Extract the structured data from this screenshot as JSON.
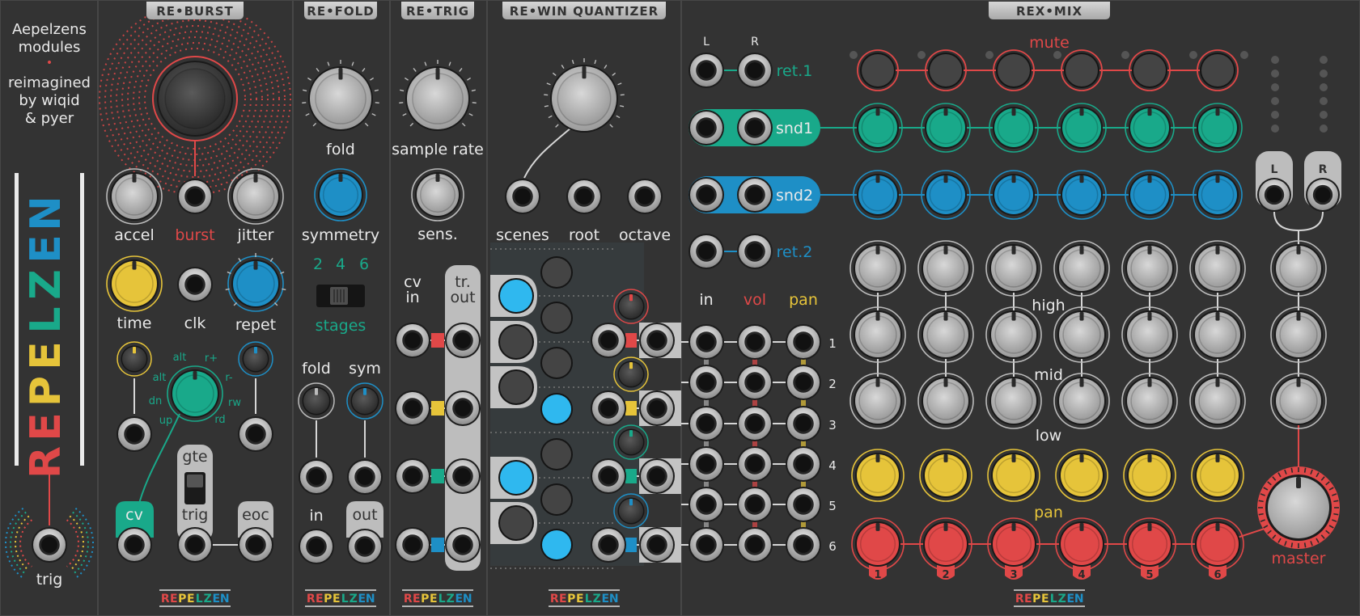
{
  "colors": {
    "panel": "#333333",
    "panel_edge": "#474747",
    "red": "#e04848",
    "green": "#19a98a",
    "blue": "#1e8fc6",
    "yellow": "#e6c43a",
    "cyan": "#34c4f5",
    "label": "#e9e9e9"
  },
  "modules": {
    "blank": {
      "credit": [
        "Aepelzens",
        "modules",
        "•",
        "reimagined",
        "by wiqid",
        "& pyer"
      ],
      "logo_letters": [
        "R",
        "E",
        "P",
        "E",
        "L",
        "Z",
        "E",
        "N"
      ],
      "trig_label": "trig"
    },
    "reburst": {
      "title": "RE•BURST",
      "labels": {
        "accel": "accel",
        "burst": "burst",
        "jitter": "jitter",
        "time": "time",
        "clk": "clk",
        "repet": "repet",
        "cv": "cv",
        "trig": "trig",
        "gte": "gte",
        "eoc": "eoc"
      },
      "mode_labels": {
        "alt_top": "alt",
        "r_plus": "r+",
        "alt_left": "alt",
        "r_minus": "r-",
        "dn": "dn",
        "rw": "rw",
        "up": "up",
        "rd": "rd"
      }
    },
    "refold": {
      "title": "RE•FOLD",
      "labels": {
        "fold": "fold",
        "symmetry": "symmetry",
        "stages": "stages",
        "fold_cv": "fold",
        "sym_cv": "sym",
        "in": "in",
        "out": "out"
      },
      "stage_numbers": [
        "2",
        "4",
        "6"
      ]
    },
    "retrig": {
      "title": "RE•TRIG",
      "labels": {
        "sample_rate": "sample rate",
        "sens": "sens.",
        "cv_in": [
          "cv",
          "in"
        ],
        "tr_out": [
          "tr.",
          "out"
        ]
      }
    },
    "rewin": {
      "title": "RE•WIN QUANTIZER",
      "labels": {
        "scenes": "scenes",
        "root": "root",
        "octave": "octave"
      }
    },
    "rexmix": {
      "title": "REX•MIX",
      "labels": {
        "L": "L",
        "R": "R",
        "ret1": "ret.1",
        "snd1": "snd1",
        "snd2": "snd2",
        "ret2": "ret.2",
        "mute": "mute",
        "in": "in",
        "vol": "vol",
        "pan": "pan",
        "high": "high",
        "mid": "mid",
        "low": "low",
        "pan_row": "pan",
        "master": "master",
        "outL": "L",
        "outR": "R"
      },
      "rows": [
        "1",
        "2",
        "3",
        "4",
        "5",
        "6"
      ],
      "channels": [
        "1",
        "2",
        "3",
        "4",
        "5",
        "6"
      ]
    }
  }
}
